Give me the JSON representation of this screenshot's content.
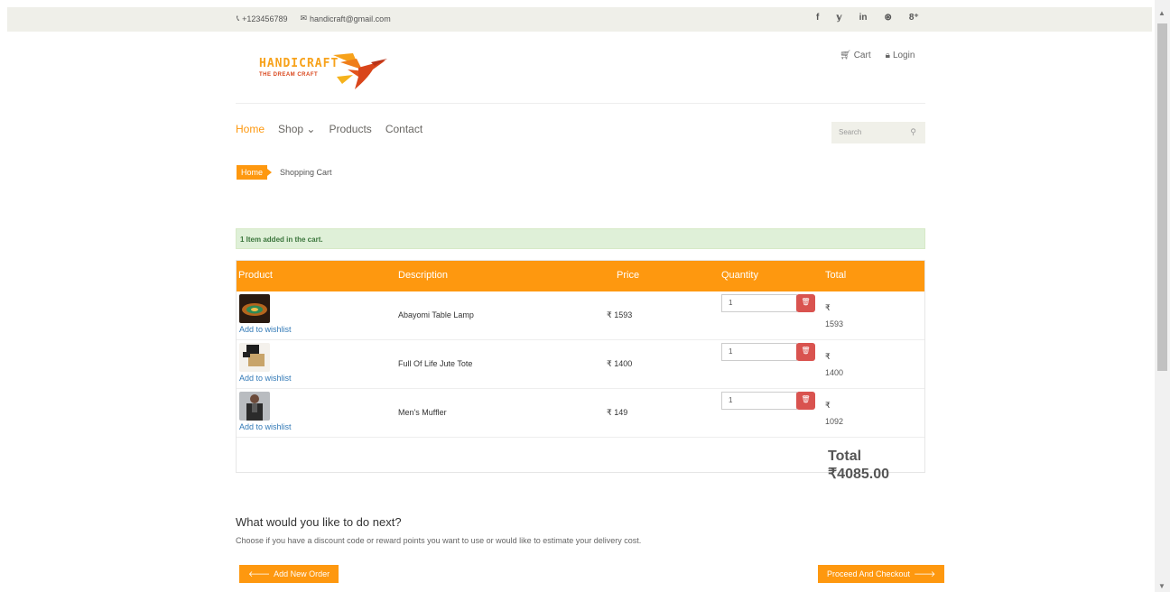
{
  "topbar": {
    "phone": "+123456789",
    "email": "handicraft@gmail.com",
    "social_icons": [
      "facebook-icon",
      "twitter-icon",
      "linkedin-icon",
      "dribbble-icon",
      "google-plus-icon"
    ],
    "social_glyphs": [
      "f",
      "𝕪",
      "in",
      "⊛",
      "8⁺"
    ]
  },
  "logo": {
    "brand": "HANDICRAFT",
    "tagline": "THE DREAM CRAFT"
  },
  "header": {
    "cart_label": "Cart",
    "login_label": "Login"
  },
  "nav": {
    "items": [
      "Home",
      "Shop",
      "Products",
      "Contact"
    ],
    "active": "Home"
  },
  "search": {
    "placeholder": "Search"
  },
  "breadcrumb": {
    "home": "Home",
    "current": "Shopping Cart"
  },
  "alert": {
    "message": "1 Item added in the cart."
  },
  "cart": {
    "columns": [
      "Product",
      "Description",
      "Price",
      "Quantity",
      "Total"
    ],
    "rows": [
      {
        "wishlist": "Add to wishlist",
        "description": "Abayomi Table Lamp",
        "price": "₹ 1593",
        "quantity": "1",
        "currency": "₹",
        "total": "1593"
      },
      {
        "wishlist": "Add to wishlist",
        "description": "Full Of Life Jute Tote",
        "price": "₹ 1400",
        "quantity": "1",
        "currency": "₹",
        "total": "1400"
      },
      {
        "wishlist": "Add to wishlist",
        "description": "Men's Muffler",
        "price": "₹ 149",
        "quantity": "1",
        "currency": "₹",
        "total": "1092"
      }
    ],
    "grand_total": "Total ₹4085.00"
  },
  "next": {
    "title": "What would you like to do next?",
    "subtitle": "Choose if you have a discount code or reward points you want to use or would like to estimate your delivery cost."
  },
  "buttons": {
    "add_new_order": "Add New Order",
    "proceed_checkout": "Proceed And Checkout"
  },
  "colors": {
    "accent": "#fe980f",
    "danger": "#d9534f",
    "alert_bg": "#dff0d8"
  }
}
